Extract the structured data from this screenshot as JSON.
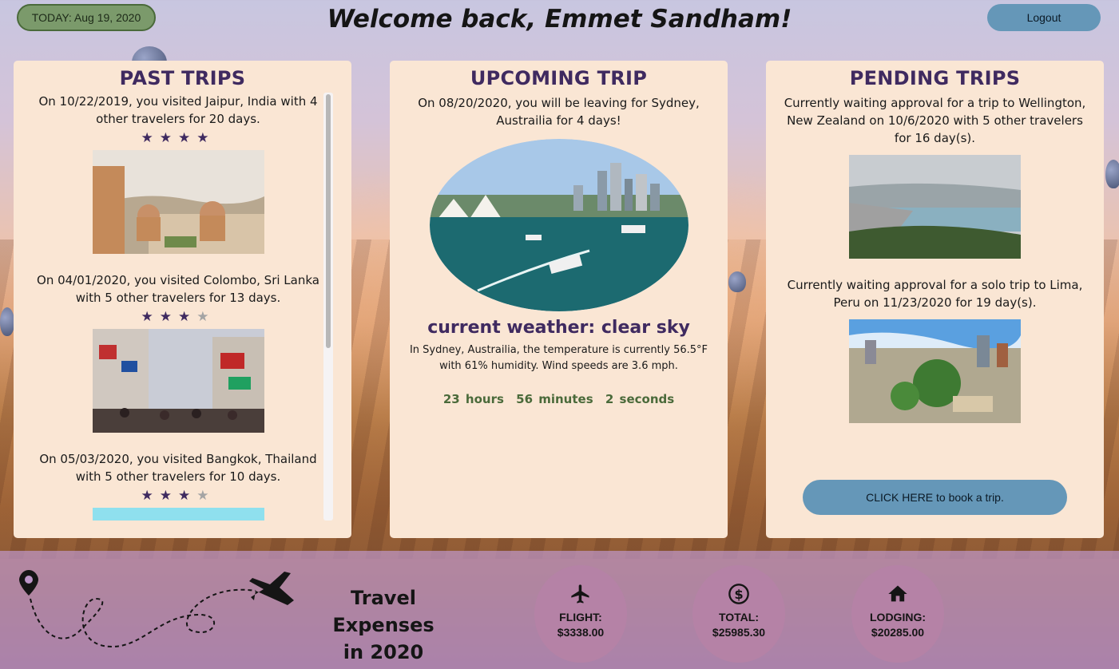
{
  "header": {
    "today": "TODAY: Aug 19, 2020",
    "welcome": "Welcome back, Emmet Sandham!",
    "logout": "Logout"
  },
  "past_trips": {
    "title": "PAST TRIPS",
    "items": [
      {
        "text": "On 10/22/2019, you visited Jaipur, India with 4 other travelers for 20 days.",
        "rating": 4,
        "image_alt": "Jaipur"
      },
      {
        "text": "On 04/01/2020, you visited Colombo, Sri Lanka with 5 other travelers for 13 days.",
        "rating": 3,
        "image_alt": "Colombo"
      },
      {
        "text": "On 05/03/2020, you visited Bangkok, Thailand with 5 other travelers for 10 days.",
        "rating": 3,
        "image_alt": "Bangkok"
      }
    ]
  },
  "upcoming_trip": {
    "title": "UPCOMING TRIP",
    "text": "On 08/20/2020, you will be leaving for Sydney, Austrailia for 4 days!",
    "weather_title": "current weather: clear sky",
    "weather_text": "In Sydney, Austrailia, the temperature is currently 56.5°F with 61% humidity. Wind speeds are 3.6 mph.",
    "countdown": {
      "hours": "23 hours",
      "minutes": "56 minutes",
      "seconds": "2 seconds"
    }
  },
  "pending_trips": {
    "title": "PENDING TRIPS",
    "items": [
      {
        "text": "Currently waiting approval for a trip to Wellington, New Zealand on 10/6/2020 with 5 other travelers for 16 day(s)."
      },
      {
        "text": "Currently waiting approval for a solo trip to Lima, Peru on 11/23/2020 for 19 day(s)."
      }
    ],
    "book_button": "CLICK HERE to book a trip."
  },
  "footer": {
    "title_line1": "Travel Expenses",
    "title_line2": "in 2020",
    "flight_label": "FLIGHT:",
    "flight_value": "$3338.00",
    "total_label": "TOTAL:",
    "total_value": "$25985.30",
    "lodging_label": "LODGING:",
    "lodging_value": "$20285.00"
  },
  "colors": {
    "panel_bg": "#fae6d4",
    "title_purple": "#3f2a60",
    "button_blue": "#6597b8",
    "badge_green": "#7b9a6b",
    "countdown_green": "#4a6a3a",
    "stat_circle": "#b582a6"
  }
}
